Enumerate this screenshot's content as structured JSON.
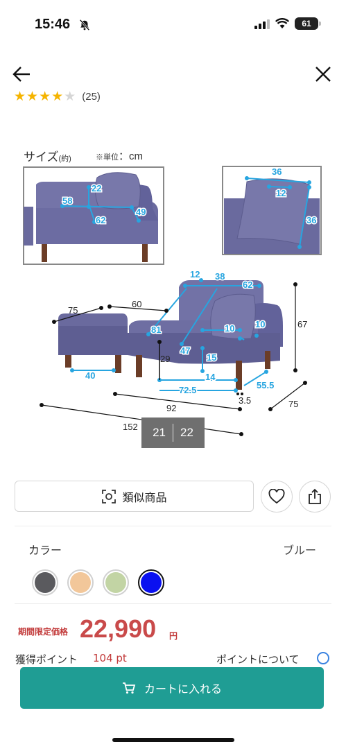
{
  "status_bar": {
    "time": "15:46",
    "battery": "61"
  },
  "rating": {
    "stars_filled": 4,
    "stars_total": 5,
    "count": "(25)"
  },
  "product_image": {
    "size_title": "サイズ",
    "size_title_note": "(約)",
    "size_unit_note": "※単位",
    "size_unit": "：cm",
    "dimensions": {
      "inset_left": [
        "22",
        "58",
        "62",
        "49"
      ],
      "inset_right": [
        "36",
        "12",
        "36"
      ],
      "main_blue": [
        "12",
        "38",
        "62",
        "81",
        "10",
        "10",
        "29",
        "47",
        "15",
        "40",
        "14",
        "72.5",
        "55.5"
      ],
      "main_black": [
        "75",
        "60",
        "67",
        "92",
        "3.5",
        "75",
        "152"
      ]
    },
    "pager": {
      "current": "21",
      "total": "22"
    }
  },
  "actions": {
    "similar_label": "類似商品"
  },
  "color": {
    "label": "カラー",
    "selected_name": "ブルー",
    "swatches": [
      "#5a5a5e",
      "#f2c79a",
      "#c2d4a4",
      "#0a10f0"
    ],
    "selected_index": 3
  },
  "price": {
    "label": "期間限定価格",
    "value": "22,990",
    "unit": "円"
  },
  "points": {
    "label": "獲得ポイント",
    "value": "104 pt",
    "about": "ポイントについて"
  },
  "cart": {
    "label": "カートに入れる"
  },
  "colors": {
    "accent": "#1f9d94",
    "price": "#c94a4a",
    "dimension": "#27a5e0",
    "sofa": "#6a6a9e"
  }
}
